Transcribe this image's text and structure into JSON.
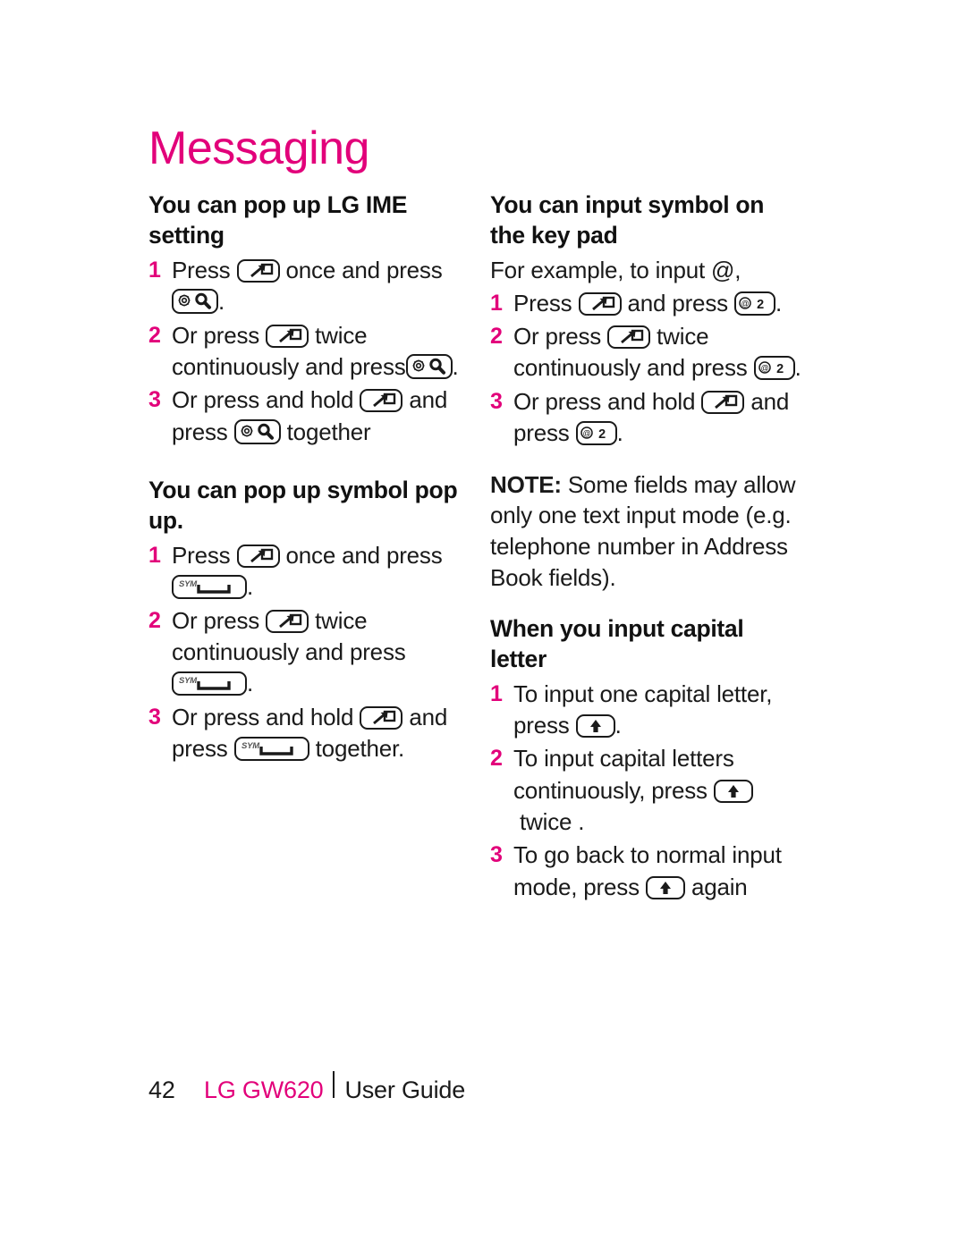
{
  "document": {
    "title": "Messaging",
    "accent_color": "#E2007A",
    "text_color": "#1a1a1a",
    "background_color": "#ffffff"
  },
  "left_column": {
    "section1": {
      "heading": "You can pop up LG IME setting",
      "steps": [
        {
          "num": "1",
          "part1": "Press",
          "key1": "tab-key",
          "part2": "once and press",
          "key2": "search-key",
          "part3": "."
        },
        {
          "num": "2",
          "part1": "Or press",
          "key1": "tab-key",
          "part2": "twice continuously and press",
          "key2": "search-key",
          "part3": "."
        },
        {
          "num": "3",
          "part1": "Or press and hold",
          "key1": "tab-key",
          "part2": "and press",
          "key2": "search-key",
          "part3": "together"
        }
      ]
    },
    "section2": {
      "heading": "You can pop up symbol pop up.",
      "steps": [
        {
          "num": "1",
          "part1": "Press",
          "key1": "tab-key",
          "part2": "once and press",
          "key2": "sym-key",
          "part3": "."
        },
        {
          "num": "2",
          "part1": "Or press",
          "key1": "tab-key",
          "part2": "twice continuously and press",
          "key2": "sym-key",
          "part3": "."
        },
        {
          "num": "3",
          "part1": "Or press and hold",
          "key1": "tab-key",
          "part2": "and press",
          "key2": "sym-key",
          "part3": "together."
        }
      ]
    }
  },
  "right_column": {
    "section1": {
      "heading": "You can input symbol on the key pad",
      "intro": "For example, to input @,",
      "steps": [
        {
          "num": "1",
          "part1": "Press",
          "key1": "tab-key",
          "part2": "and press",
          "key2": "at-2-key",
          "part3": "."
        },
        {
          "num": "2",
          "part1": "Or press",
          "key1": "tab-key",
          "part2": "twice continuously and press",
          "key2": "at-2-key",
          "part3": "."
        },
        {
          "num": "3",
          "part1": "Or press and hold",
          "key1": "tab-key",
          "part2": "and press",
          "key2": "at-2-key",
          "part3": "."
        }
      ]
    },
    "note": {
      "label": "NOTE:",
      "text": " Some fields may allow only one text input mode (e.g. telephone number in Address Book fields)."
    },
    "section2": {
      "heading": "When you input capital letter",
      "steps": [
        {
          "num": "1",
          "part1": "To input one capital letter, press",
          "key1": "shift-key",
          "part2": ".",
          "key2": "",
          "part3": ""
        },
        {
          "num": "2",
          "part1": "To input capital letters continuously, press",
          "key1": "shift-key",
          "part2": "twice .",
          "key2": "",
          "part3": ""
        },
        {
          "num": "3",
          "part1": "To go back to normal input mode, press",
          "key1": "shift-key",
          "part2": "again",
          "key2": "",
          "part3": ""
        }
      ]
    }
  },
  "keys": {
    "tab_key": {
      "name": "tab-key",
      "glyph": "arrow-into-box"
    },
    "search_key": {
      "name": "search-key",
      "glyph": "gear-and-magnifier"
    },
    "sym_key": {
      "name": "sym-key",
      "label": "SYM",
      "glyph": "spacebar"
    },
    "at_2_key": {
      "name": "at-2-key",
      "label_small": "@",
      "label_main": "2"
    },
    "shift_key": {
      "name": "shift-key",
      "glyph": "filled-up-arrow"
    }
  },
  "footer": {
    "page_number": "42",
    "brand": "LG GW620",
    "divider": "|",
    "guide": "User Guide"
  }
}
